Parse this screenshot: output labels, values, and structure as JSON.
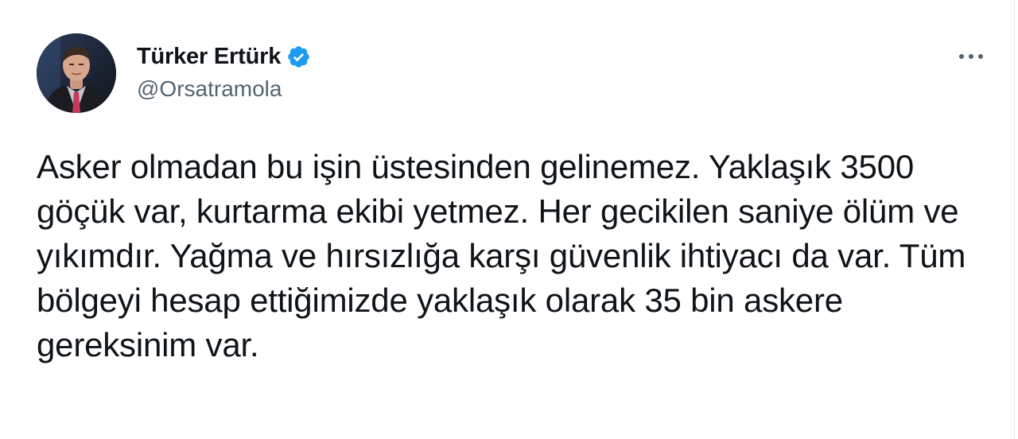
{
  "author": {
    "display_name": "Türker Ertürk",
    "handle": "@Orsatramola",
    "verified": true,
    "avatar": "profile-photo"
  },
  "actions": {
    "more_icon": "more-horizontal-icon"
  },
  "tweet": {
    "text": "Asker olmadan bu işin üstesinden gelinemez. Yaklaşık 3500 göçük var, kurtarma ekibi yetmez. Her gecikilen saniye ölüm ve yıkımdır. Yağma ve hırsızlığa karşı güvenlik ihtiyacı da var. Tüm bölgeyi hesap ettiğimizde yaklaşık olarak 35 bin askere gereksinim var."
  },
  "colors": {
    "text_primary": "#0f1419",
    "text_secondary": "#536471",
    "verified_blue": "#1d9bf0",
    "background": "#ffffff"
  }
}
